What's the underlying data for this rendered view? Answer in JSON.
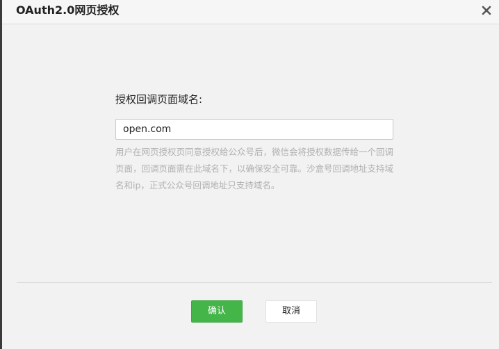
{
  "dialog": {
    "title": "OAuth2.0网页授权",
    "close_icon": "close-icon"
  },
  "form": {
    "label": "授权回调页面域名:",
    "domain_value": "open.com",
    "hint": "用户在网页授权页同意授权给公众号后，微信会将授权数据传给一个回调页面，回调页面需在此域名下，以确保安全可靠。沙盒号回调地址支持域名和ip，正式公众号回调地址只支持域名。"
  },
  "footer": {
    "confirm_label": "确认",
    "cancel_label": "取消"
  },
  "colors": {
    "primary_button": "#44b549",
    "background": "#f2f2f2"
  }
}
